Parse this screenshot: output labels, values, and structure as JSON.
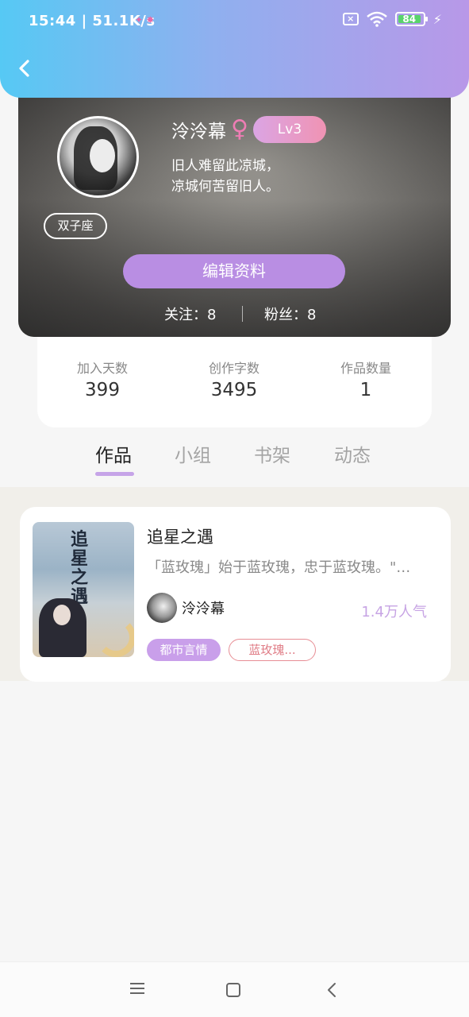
{
  "status_bar": {
    "time": "15:44",
    "net_speed": "51.1K/s",
    "battery": "84"
  },
  "profile": {
    "username": "泠泠幕",
    "gender_icon": "female-icon",
    "level": "Lv3",
    "bio_line1": "旧人难留此凉城，",
    "bio_line2": "凉城何苦留旧人。",
    "zodiac": "双子座",
    "edit_label": "编辑资料",
    "following": "关注：8",
    "followers": "粉丝：8"
  },
  "stats": [
    {
      "label": "加入天数",
      "value": "399"
    },
    {
      "label": "创作字数",
      "value": "3495"
    },
    {
      "label": "作品数量",
      "value": "1"
    }
  ],
  "tabs": [
    {
      "label": "作品",
      "active": true
    },
    {
      "label": "小组",
      "active": false
    },
    {
      "label": "书架",
      "active": false
    },
    {
      "label": "动态",
      "active": false
    }
  ],
  "works": [
    {
      "title": "追星之遇",
      "cover_title": "追星之遇",
      "description": "「蓝玫瑰」始于蓝玫瑰，忠于蓝玫瑰。\"…",
      "author": "泠泠幕",
      "popularity": "1.4万人气",
      "tags": [
        "都市言情",
        "蓝玫瑰..."
      ]
    }
  ],
  "colors": {
    "header_gradient_start": "#56c9f4",
    "header_gradient_end": "#b898e8",
    "accent_purple": "#b98ee3",
    "tag_outline_red": "#e78e95"
  }
}
